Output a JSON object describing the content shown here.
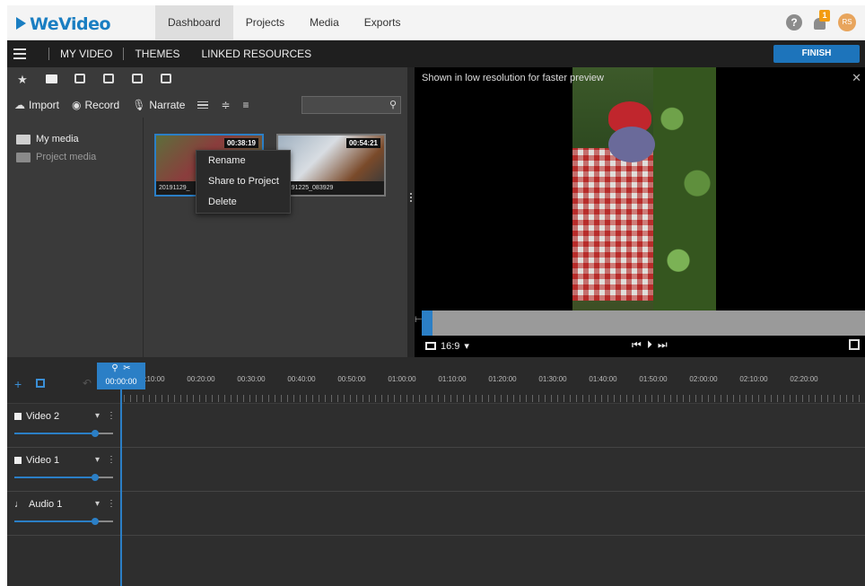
{
  "app": {
    "logo_text": "WeVideo",
    "accent_color": "#1d74bb"
  },
  "topnav": {
    "tabs": [
      {
        "label": "Dashboard",
        "active": true
      },
      {
        "label": "Projects",
        "active": false
      },
      {
        "label": "Media",
        "active": false
      },
      {
        "label": "Exports",
        "active": false
      }
    ],
    "notification_count": "1",
    "avatar_initials": "RS"
  },
  "secondbar": {
    "items": [
      "MY VIDEO",
      "THEMES",
      "LINKED RESOURCES"
    ],
    "finish_label": "FINISH"
  },
  "media": {
    "toolbar": {
      "import_label": "Import",
      "record_label": "Record",
      "narrate_label": "Narrate",
      "search_placeholder": ""
    },
    "folders": [
      {
        "label": "My media",
        "active": true
      },
      {
        "label": "Project media",
        "active": false
      }
    ],
    "clips": [
      {
        "name": "20191129_",
        "duration": "00:38:19",
        "selected": true
      },
      {
        "name": "20191225_083929",
        "duration": "00:54:21",
        "selected": false
      }
    ],
    "context_menu": [
      "Rename",
      "Share to Project",
      "Delete"
    ]
  },
  "preview": {
    "note": "Shown in low resolution for faster preview",
    "aspect_ratio": "16:9",
    "progress": 0.024
  },
  "timeline": {
    "playhead_time": "00:00:00",
    "ticks": [
      "00:10:00",
      "00:20:00",
      "00:30:00",
      "00:40:00",
      "00:50:00",
      "01:00:00",
      "01:10:00",
      "01:20:00",
      "01:30:00",
      "01:40:00",
      "01:50:00",
      "02:00:00",
      "02:10:00",
      "02:20:00"
    ],
    "tracks": [
      {
        "name": "Video 2",
        "type": "video",
        "volume": 0.82
      },
      {
        "name": "Video 1",
        "type": "video",
        "volume": 0.82
      },
      {
        "name": "Audio 1",
        "type": "audio",
        "volume": 0.82
      }
    ]
  }
}
